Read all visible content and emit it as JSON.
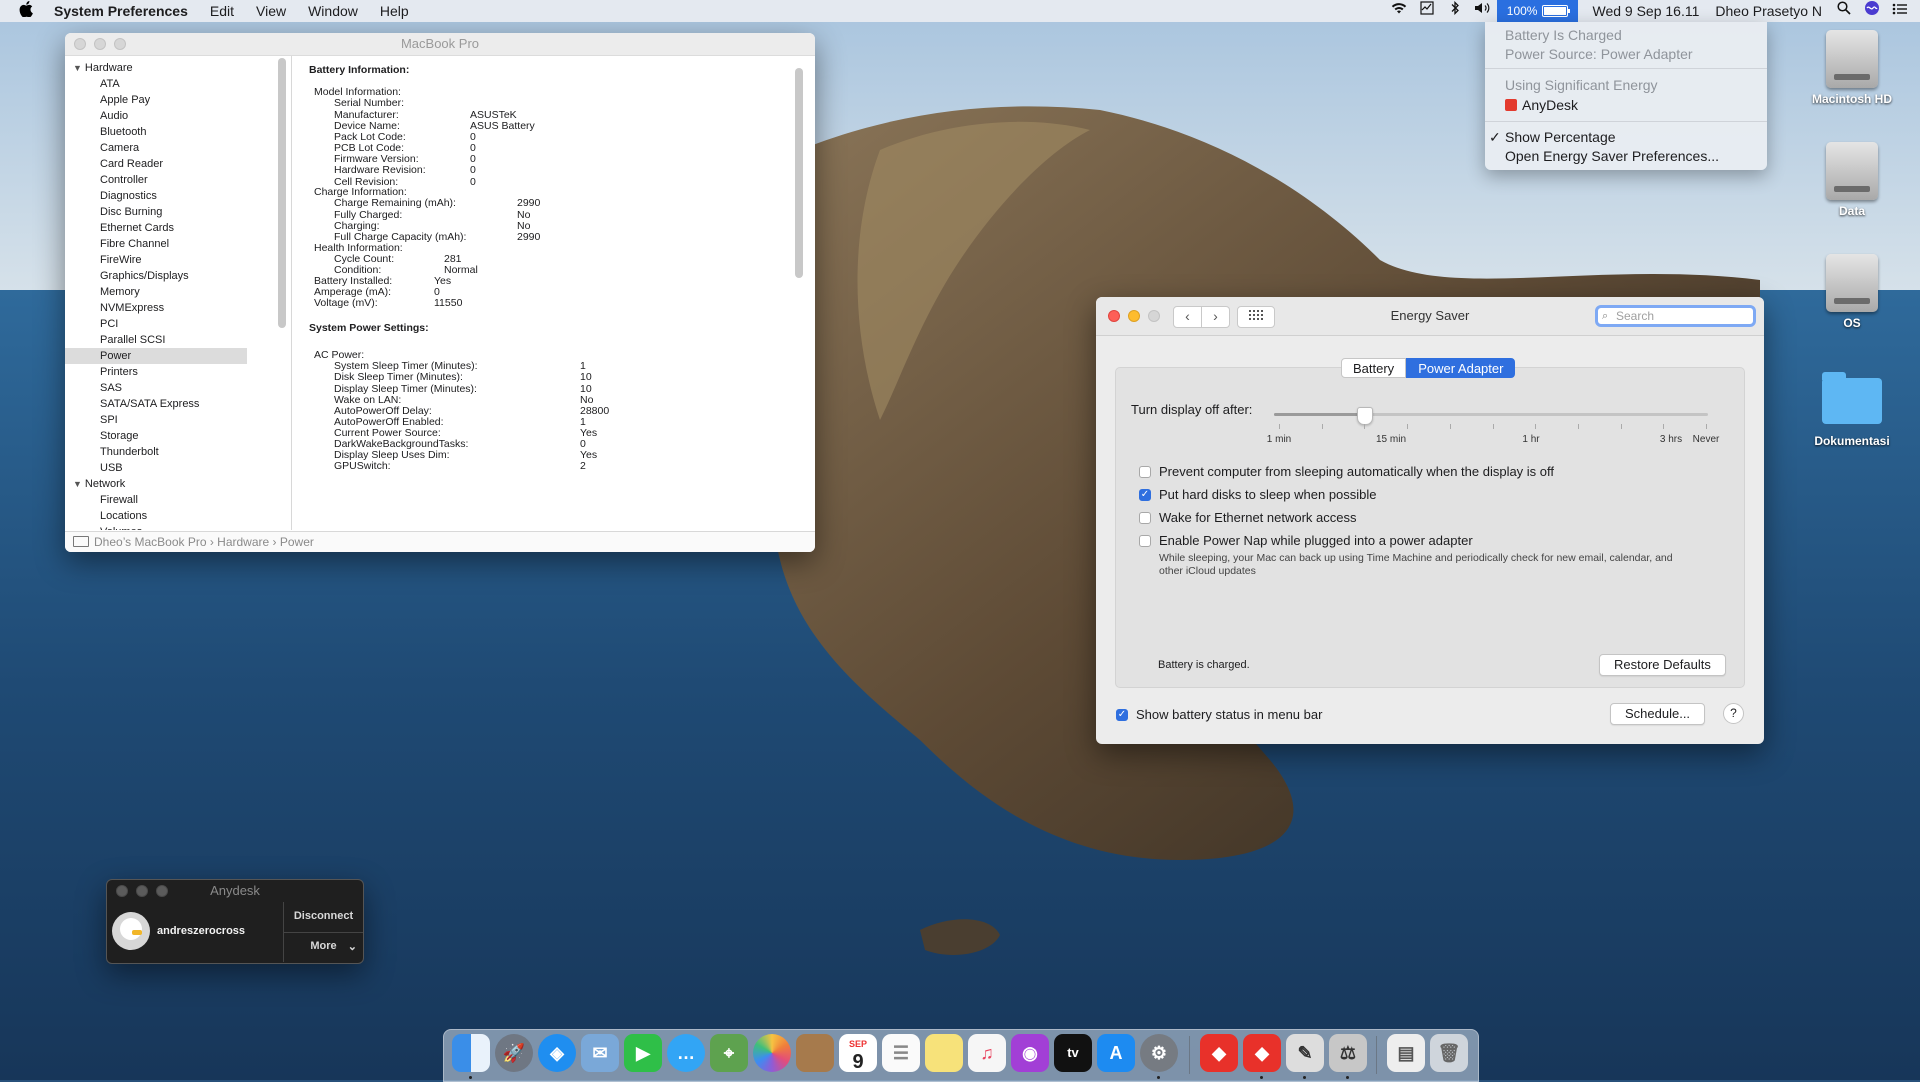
{
  "menubar": {
    "apple": "",
    "app_name": "System Preferences",
    "menus": [
      "Edit",
      "View",
      "Window",
      "Help"
    ],
    "battery_percent": "100%",
    "battery_level": 1.0,
    "datetime": "Wed 9 Sep  16.11",
    "user": "Dheo Prasetyo N"
  },
  "battery_menu": {
    "status": "Battery Is Charged",
    "source": "Power Source: Power Adapter",
    "energy_header": "Using Significant Energy",
    "energy_app": "AnyDesk",
    "show_percentage_check": "✓",
    "show_percentage": "Show Percentage",
    "open_prefs": "Open Energy Saver Preferences..."
  },
  "sysinfo": {
    "title": "MacBook Pro",
    "sidebar": {
      "hardware_group": "Hardware",
      "hardware_items": [
        "ATA",
        "Apple Pay",
        "Audio",
        "Bluetooth",
        "Camera",
        "Card Reader",
        "Controller",
        "Diagnostics",
        "Disc Burning",
        "Ethernet Cards",
        "Fibre Channel",
        "FireWire",
        "Graphics/Displays",
        "Memory",
        "NVMExpress",
        "PCI",
        "Parallel SCSI",
        "Power",
        "Printers",
        "SAS",
        "SATA/SATA Express",
        "SPI",
        "Storage",
        "Thunderbolt",
        "USB"
      ],
      "network_group": "Network",
      "network_items": [
        "Firewall",
        "Locations",
        "Volumes"
      ],
      "selected": "Power"
    },
    "content": {
      "battery_info_h": "Battery Information:",
      "model_info_h": "Model Information:",
      "serial_l": "Serial Number:",
      "serial_v": "",
      "manufacturer_l": "Manufacturer:",
      "manufacturer_v": "ASUSTeK",
      "device_l": "Device Name:",
      "device_v": "ASUS Battery",
      "packlot_l": "Pack Lot Code:",
      "packlot_v": "0",
      "pcblot_l": "PCB Lot Code:",
      "pcblot_v": "0",
      "firmware_l": "Firmware Version:",
      "firmware_v": "0",
      "hardware_l": "Hardware Revision:",
      "hardware_v": "0",
      "cell_l": "Cell Revision:",
      "cell_v": "0",
      "charge_info_h": "Charge Information:",
      "remaining_l": "Charge Remaining (mAh):",
      "remaining_v": "2990",
      "fully_l": "Fully Charged:",
      "fully_v": "No",
      "charging_l": "Charging:",
      "charging_v": "No",
      "fullcap_l": "Full Charge Capacity (mAh):",
      "fullcap_v": "2990",
      "health_info_h": "Health Information:",
      "cycle_l": "Cycle Count:",
      "cycle_v": "281",
      "condition_l": "Condition:",
      "condition_v": "Normal",
      "installed_l": "Battery Installed:",
      "installed_v": "Yes",
      "amperage_l": "Amperage (mA):",
      "amperage_v": "0",
      "voltage_l": "Voltage (mV):",
      "voltage_v": "11550",
      "sys_power_h": "System Power Settings:",
      "ac_power_h": "AC Power:",
      "sst_l": "System Sleep Timer (Minutes):",
      "sst_v": "1",
      "dst_l": "Disk Sleep Timer (Minutes):",
      "dst_v": "10",
      "dispst_l": "Display Sleep Timer (Minutes):",
      "dispst_v": "10",
      "wol_l": "Wake on LAN:",
      "wol_v": "No",
      "apod_l": "AutoPowerOff Delay:",
      "apod_v": "28800",
      "apoe_l": "AutoPowerOff Enabled:",
      "apoe_v": "1",
      "cps_l": "Current Power Source:",
      "cps_v": "Yes",
      "dwbt_l": "DarkWakeBackgroundTasks:",
      "dwbt_v": "0",
      "dsud_l": "Display Sleep Uses Dim:",
      "dsud_v": "Yes",
      "gpu_l": "GPUSwitch:",
      "gpu_v": "2"
    },
    "path": "Dheo’s MacBook Pro › Hardware › Power"
  },
  "energy_saver": {
    "title": "Energy Saver",
    "search_placeholder": "Search",
    "tab_battery": "Battery",
    "tab_power_adapter": "Power Adapter",
    "active_tab": "Power Adapter",
    "display_off_label": "Turn display off after:",
    "slider_value": "15 min",
    "slider_labels": [
      "1 min",
      "15 min",
      "1 hr",
      "3 hrs",
      "Never"
    ],
    "opt_prevent_sleep": "Prevent computer from sleeping automatically when the display is off",
    "opt_prevent_sleep_checked": false,
    "opt_hard_disks": "Put hard disks to sleep when possible",
    "opt_hard_disks_checked": true,
    "opt_wake_ethernet": "Wake for Ethernet network access",
    "opt_wake_ethernet_checked": false,
    "opt_power_nap": "Enable Power Nap while plugged into a power adapter",
    "opt_power_nap_checked": false,
    "power_nap_desc": "While sleeping, your Mac can back up using Time Machine and periodically check for new email, calendar, and other iCloud updates",
    "battery_status": "Battery is charged.",
    "restore_defaults": "Restore Defaults",
    "show_battery_status": "Show battery status in menu bar",
    "show_battery_status_checked": true,
    "schedule": "Schedule...",
    "help": "?"
  },
  "anydesk": {
    "title": "Anydesk",
    "user": "andreszerocross",
    "disconnect": "Disconnect",
    "more": "More"
  },
  "desktop_icons": [
    "Macintosh HD",
    "Data",
    "OS",
    "Dokumentasi"
  ],
  "dock": {
    "calendar_month": "SEP",
    "calendar_day": "9",
    "tv_label": "tv"
  }
}
